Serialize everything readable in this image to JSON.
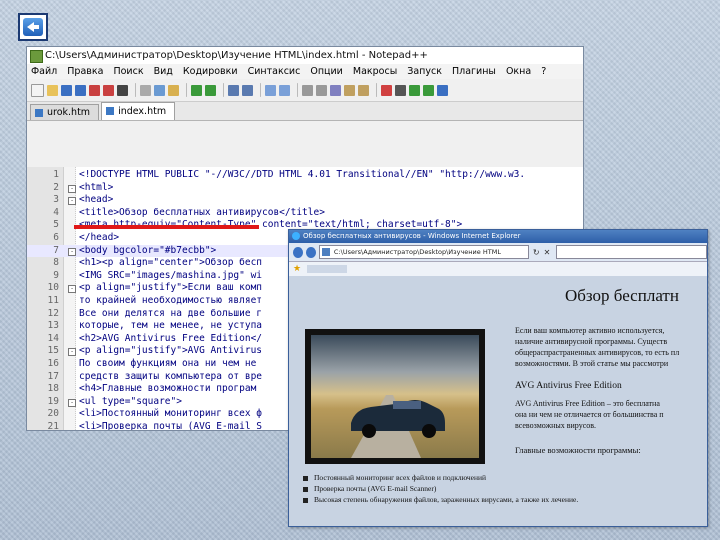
{
  "back_button": {
    "icon": "back-arrow-icon"
  },
  "notepad": {
    "title": "C:\\Users\\Администратор\\Desktop\\Изучение HTML\\index.html - Notepad++",
    "menu": [
      "Файл",
      "Правка",
      "Поиск",
      "Вид",
      "Кодировки",
      "Синтаксис",
      "Опции",
      "Макросы",
      "Запуск",
      "Плагины",
      "Окна",
      "?"
    ],
    "tabs": [
      {
        "label": "urok.htm",
        "active": false
      },
      {
        "label": "index.htm",
        "active": true
      }
    ],
    "lines": [
      {
        "num": "1",
        "text": "<!DOCTYPE HTML PUBLIC \"-//W3C//DTD HTML 4.01 Transitional//EN\" \"http://www.w3.",
        "fold": ""
      },
      {
        "num": "2",
        "text": "<html>",
        "fold": "-"
      },
      {
        "num": "3",
        "text": "<head>",
        "fold": "-"
      },
      {
        "num": "4",
        "text": "<title>Обзор бесплатных антивирусов</title>",
        "fold": ""
      },
      {
        "num": "5",
        "text": "<meta http-equiv=\"Content-Type\" content=\"text/html; charset=utf-8\">",
        "fold": ""
      },
      {
        "num": "6",
        "text": "</head>",
        "fold": ""
      },
      {
        "num": "7",
        "text": "<body bgcolor=\"#b7ecbb\">",
        "fold": "-"
      },
      {
        "num": "8",
        "text": "<h1><p align=\"center\">Обзор бесп",
        "fold": ""
      },
      {
        "num": "9",
        "text": "<IMG SRC=\"images/mashina.jpg\" wi",
        "fold": ""
      },
      {
        "num": "10",
        "text": "<p align=\"justify\">Если ваш комп",
        "fold": "-"
      },
      {
        "num": "11",
        "text": "то крайней необходимостью являет",
        "fold": ""
      },
      {
        "num": "12",
        "text": "Все они делятся на две большие г",
        "fold": ""
      },
      {
        "num": "13",
        "text": "которые, тем не менее, не уступа",
        "fold": ""
      },
      {
        "num": "14",
        "text": "<h2>AVG Antivirus Free Edition</",
        "fold": ""
      },
      {
        "num": "15",
        "text": "<p align=\"justify\">AVG Antivirus",
        "fold": "-"
      },
      {
        "num": "16",
        "text": "По своим функциям она ни чем не",
        "fold": ""
      },
      {
        "num": "17",
        "text": "средств защиты компьютера от вре",
        "fold": ""
      },
      {
        "num": "18",
        "text": "<h4>Главные возможности програм",
        "fold": ""
      },
      {
        "num": "19",
        "text": "<ul type=\"square\">",
        "fold": "-"
      },
      {
        "num": "20",
        "text": "<li>Постоянный мониторинг всех ф",
        "fold": ""
      },
      {
        "num": "21",
        "text": "<li>Проверка почты (AVG E-mail S",
        "fold": ""
      }
    ]
  },
  "ie": {
    "title": "Обзор бесплатных антивирусов - Windows Internet Explorer",
    "url": "C:\\Users\\Администратор\\Desktop\\Изучение HTML",
    "heading": "Обзор бесплатн",
    "paragraphs": [
      "Если ваш компьютер активно используется,",
      "наличие антивирусной программы. Существ",
      "общераспрастраненных антивирусов, то есть пл",
      "возможностями. В этой статье мы рассмотри"
    ],
    "h2": "AVG Antivirus Free Edition",
    "paragraphs2": [
      "AVG Antivirus Free Edition – это бесплатна",
      "она ни чем не отличается от большинства п",
      "всевозможных вирусов."
    ],
    "h4": "Главные возможности программы:",
    "bullets": [
      "Постоянный мониторинг всех файлов и подключений",
      "Проверка почты (AVG E-mail Scanner)",
      "Высокая степень обнаружения файлов, зараженных вирусами, а также их лечение."
    ]
  }
}
